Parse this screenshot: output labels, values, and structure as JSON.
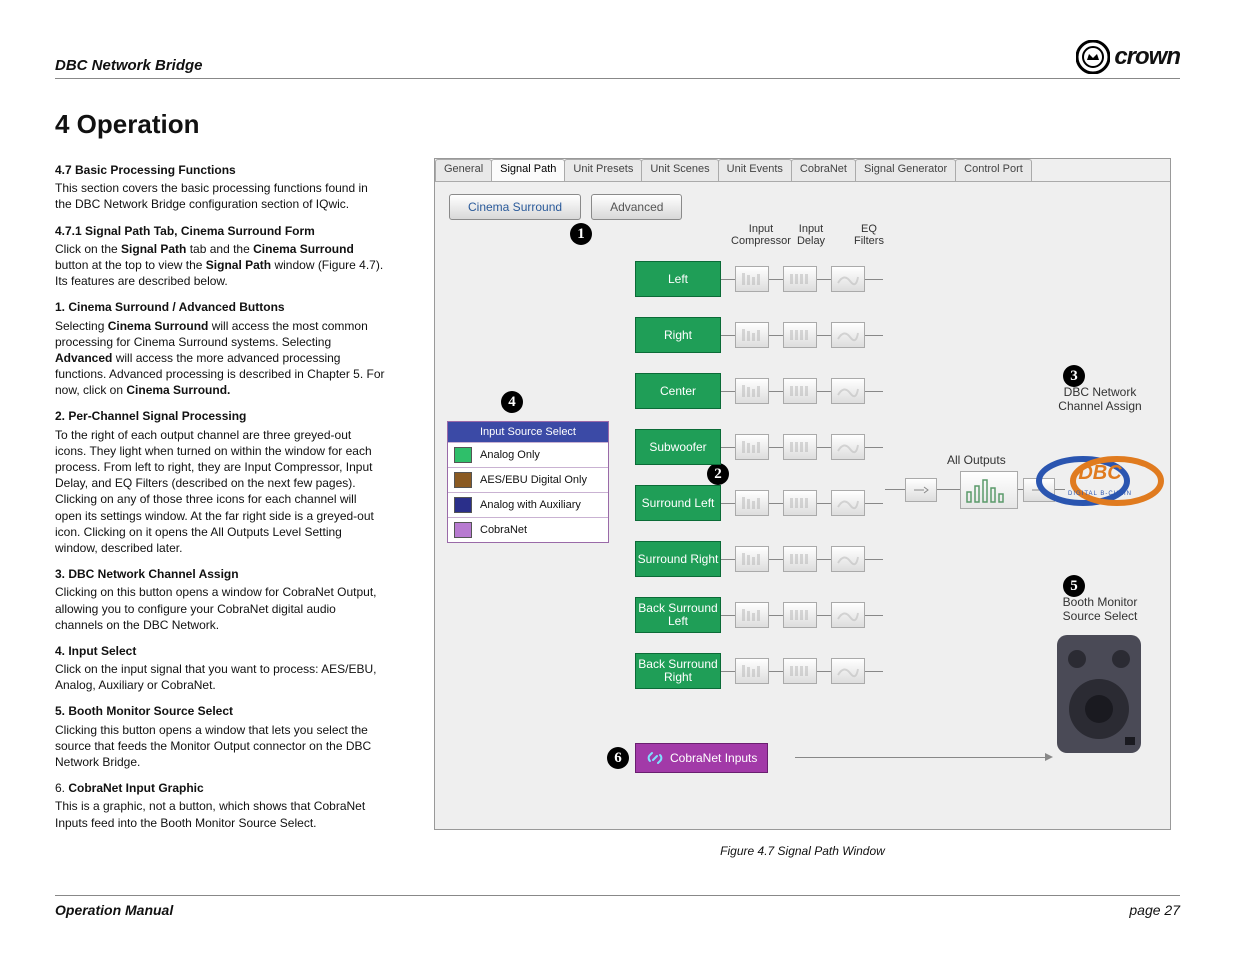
{
  "header": {
    "doc_title": "DBC Network Bridge",
    "brand": "crown"
  },
  "section_title": "4 Operation",
  "left": {
    "s1_head": "4.7 Basic Processing Functions",
    "s1_body": "This section covers the basic processing functions found in the DBC Network Bridge configuration section of IQwic.",
    "s2_head": "4.7.1 Signal Path Tab, Cinema Surround Form",
    "s2_pre": "Click on the ",
    "s2_b1": "Signal Path",
    "s2_mid1": " tab and the ",
    "s2_b2": "Cinema Surround",
    "s2_mid2": " button at the top to view the ",
    "s2_b3": "Signal Path",
    "s2_post": " window (Figure 4.7). Its features are described below.",
    "s3_head": "1. Cinema Surround / Advanced Buttons",
    "s3_pre": "Selecting ",
    "s3_b1": "Cinema Surround",
    "s3_mid1": " will access the most common processing for Cinema Surround systems. Selecting ",
    "s3_b2": "Advanced",
    "s3_mid2": " will access the more advanced processing functions. Advanced processing is described in Chapter 5. For now, click on ",
    "s3_b3": "Cinema Surround.",
    "s4_head": "2. Per-Channel Signal Processing",
    "s4_body": "To the right of each output channel are three greyed-out icons. They light when turned on within the window for each process. From left to right, they are Input Compressor, Input Delay, and EQ Filters (described on the next few pages). Clicking on any of those three icons for each channel will open its settings window. At the far right side is a greyed-out icon. Clicking on it opens the All Outputs Level Setting window, described later.",
    "s5_head": "3. DBC Network Channel Assign",
    "s5_body": "Clicking on this button opens a window for CobraNet Output, allowing you to configure your CobraNet digital audio channels on the DBC Network.",
    "s6_head": "4. Input Select",
    "s6_body": "Click on the input signal that you want to process: AES/EBU, Analog, Auxiliary or CobraNet.",
    "s7_head": "5. Booth Monitor Source Select",
    "s7_body": "Clicking this button opens a window that lets you select the source that feeds the Monitor Output connector on the DBC Network Bridge.",
    "s8_num": "6. ",
    "s8_head": "CobraNet Input Graphic",
    "s8_body": "This is a graphic, not a button, which shows that CobraNet Inputs feed into the Booth Monitor Source Select."
  },
  "figure": {
    "tabs": [
      "General",
      "Signal Path",
      "Unit Presets",
      "Unit Scenes",
      "Unit Events",
      "CobraNet",
      "Signal Generator",
      "Control Port"
    ],
    "subtabs": [
      "Cinema Surround",
      "Advanced"
    ],
    "col_headers": {
      "c1a": "Input",
      "c1b": "Compressor",
      "c2a": "Input",
      "c2b": "Delay",
      "c3a": "EQ",
      "c3b": "Filters"
    },
    "channels": [
      "Left",
      "Right",
      "Center",
      "Subwoofer",
      "Surround Left",
      "Surround Right",
      "Back Surround Left",
      "Back Surround Right"
    ],
    "legend_title": "Input Source Select",
    "legend_items": [
      {
        "color": "#2fbf6a",
        "label": "Analog Only"
      },
      {
        "color": "#8a5a22",
        "label": "AES/EBU Digital Only"
      },
      {
        "color": "#2a2f8a",
        "label": "Analog with Auxiliary"
      },
      {
        "color": "#b77ad0",
        "label": "CobraNet"
      }
    ],
    "cobranet_label": "CobraNet Inputs",
    "all_outputs_label": "All Outputs",
    "r_label_3a": "DBC Network",
    "r_label_3b": "Channel Assign",
    "r_label_5a": "Booth Monitor",
    "r_label_5b": "Source Select",
    "callouts": {
      "1": "1",
      "2": "2",
      "3": "3",
      "4": "4",
      "5": "5",
      "6": "6"
    },
    "caption": "Figure 4.7  Signal Path Window"
  },
  "footer": {
    "left": "Operation Manual",
    "right": "page 27"
  }
}
